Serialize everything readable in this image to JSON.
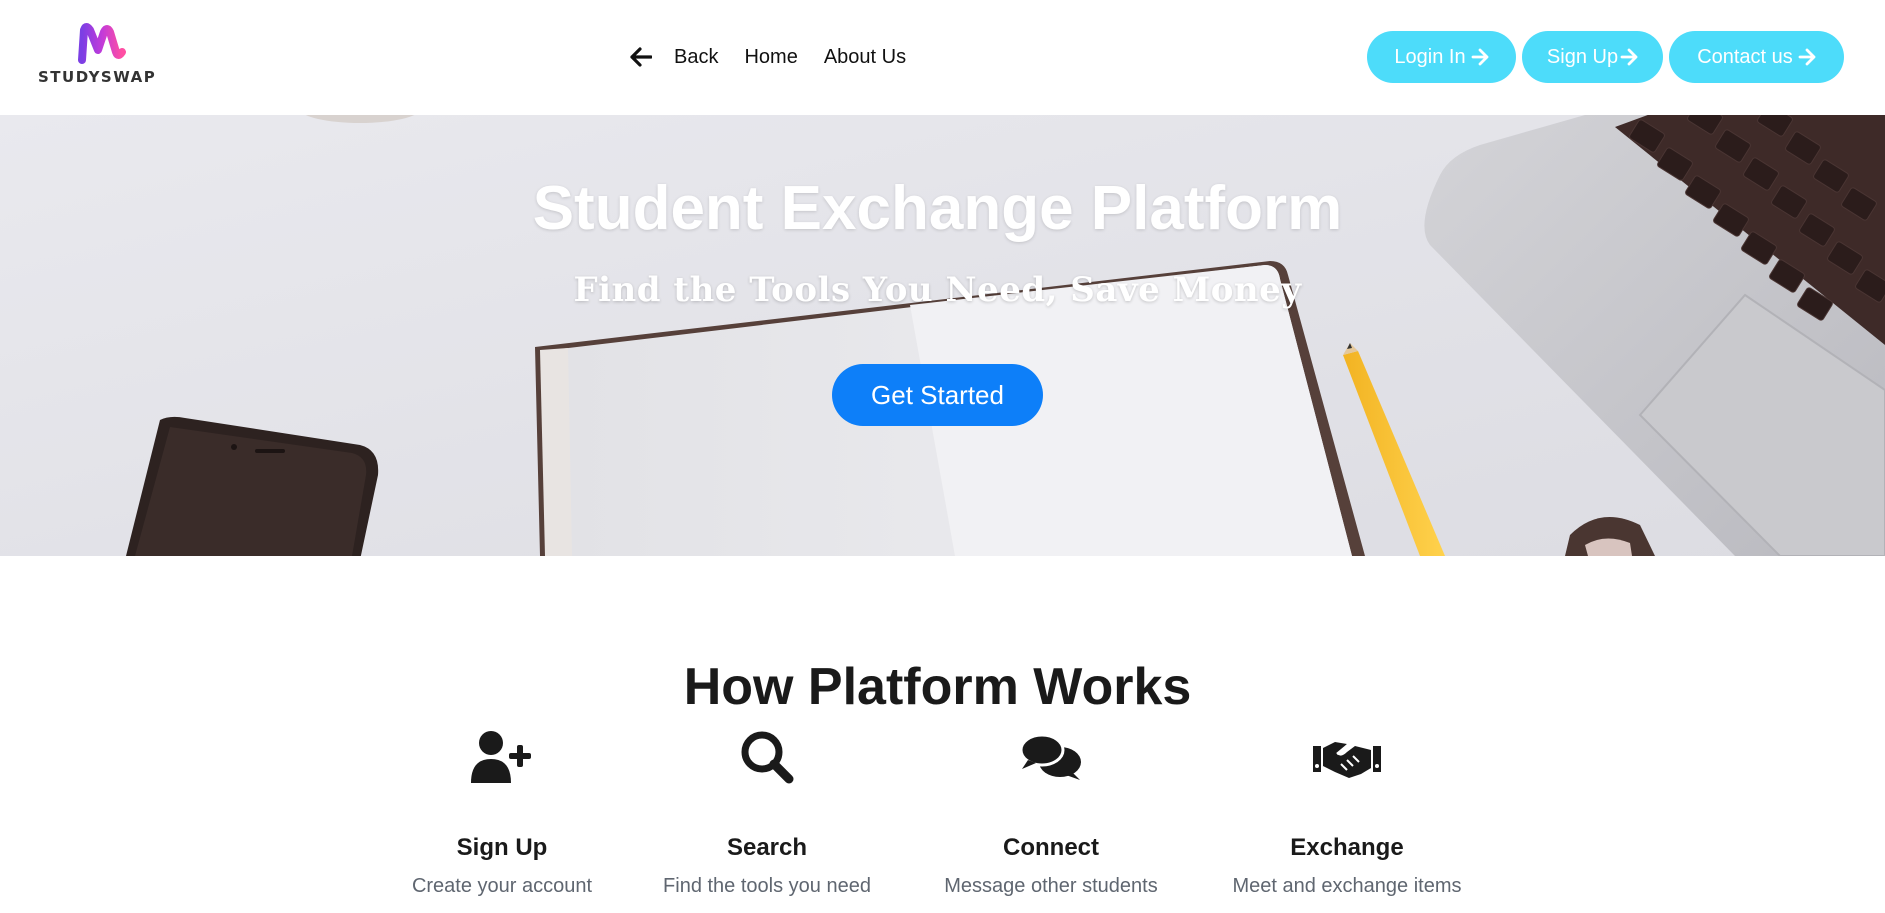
{
  "header": {
    "logo_text": "STUDYSWAP",
    "nav": {
      "back_icon": "arrow-left-icon",
      "back_label": "Back",
      "home_label": "Home",
      "about_label": "About Us"
    },
    "buttons": {
      "login_label": "Login In",
      "signup_label": "Sign Up",
      "contact_label": "Contact us",
      "arrow_icon": "arrow-right-icon",
      "color": "#4ddcfa"
    }
  },
  "hero": {
    "title": "Student Exchange Platform",
    "subtitle": "Find the Tools You Need, Save Money",
    "cta_label": "Get Started",
    "cta_color": "#0d7ff9"
  },
  "how": {
    "title": "How Platform Works",
    "steps": [
      {
        "icon": "user-plus-icon",
        "title": "Sign Up",
        "desc": "Create your account"
      },
      {
        "icon": "search-icon",
        "title": "Search",
        "desc": "Find the tools you need"
      },
      {
        "icon": "comments-icon",
        "title": "Connect",
        "desc": "Message other students"
      },
      {
        "icon": "handshake-icon",
        "title": "Exchange",
        "desc": "Meet and exchange items"
      }
    ]
  }
}
